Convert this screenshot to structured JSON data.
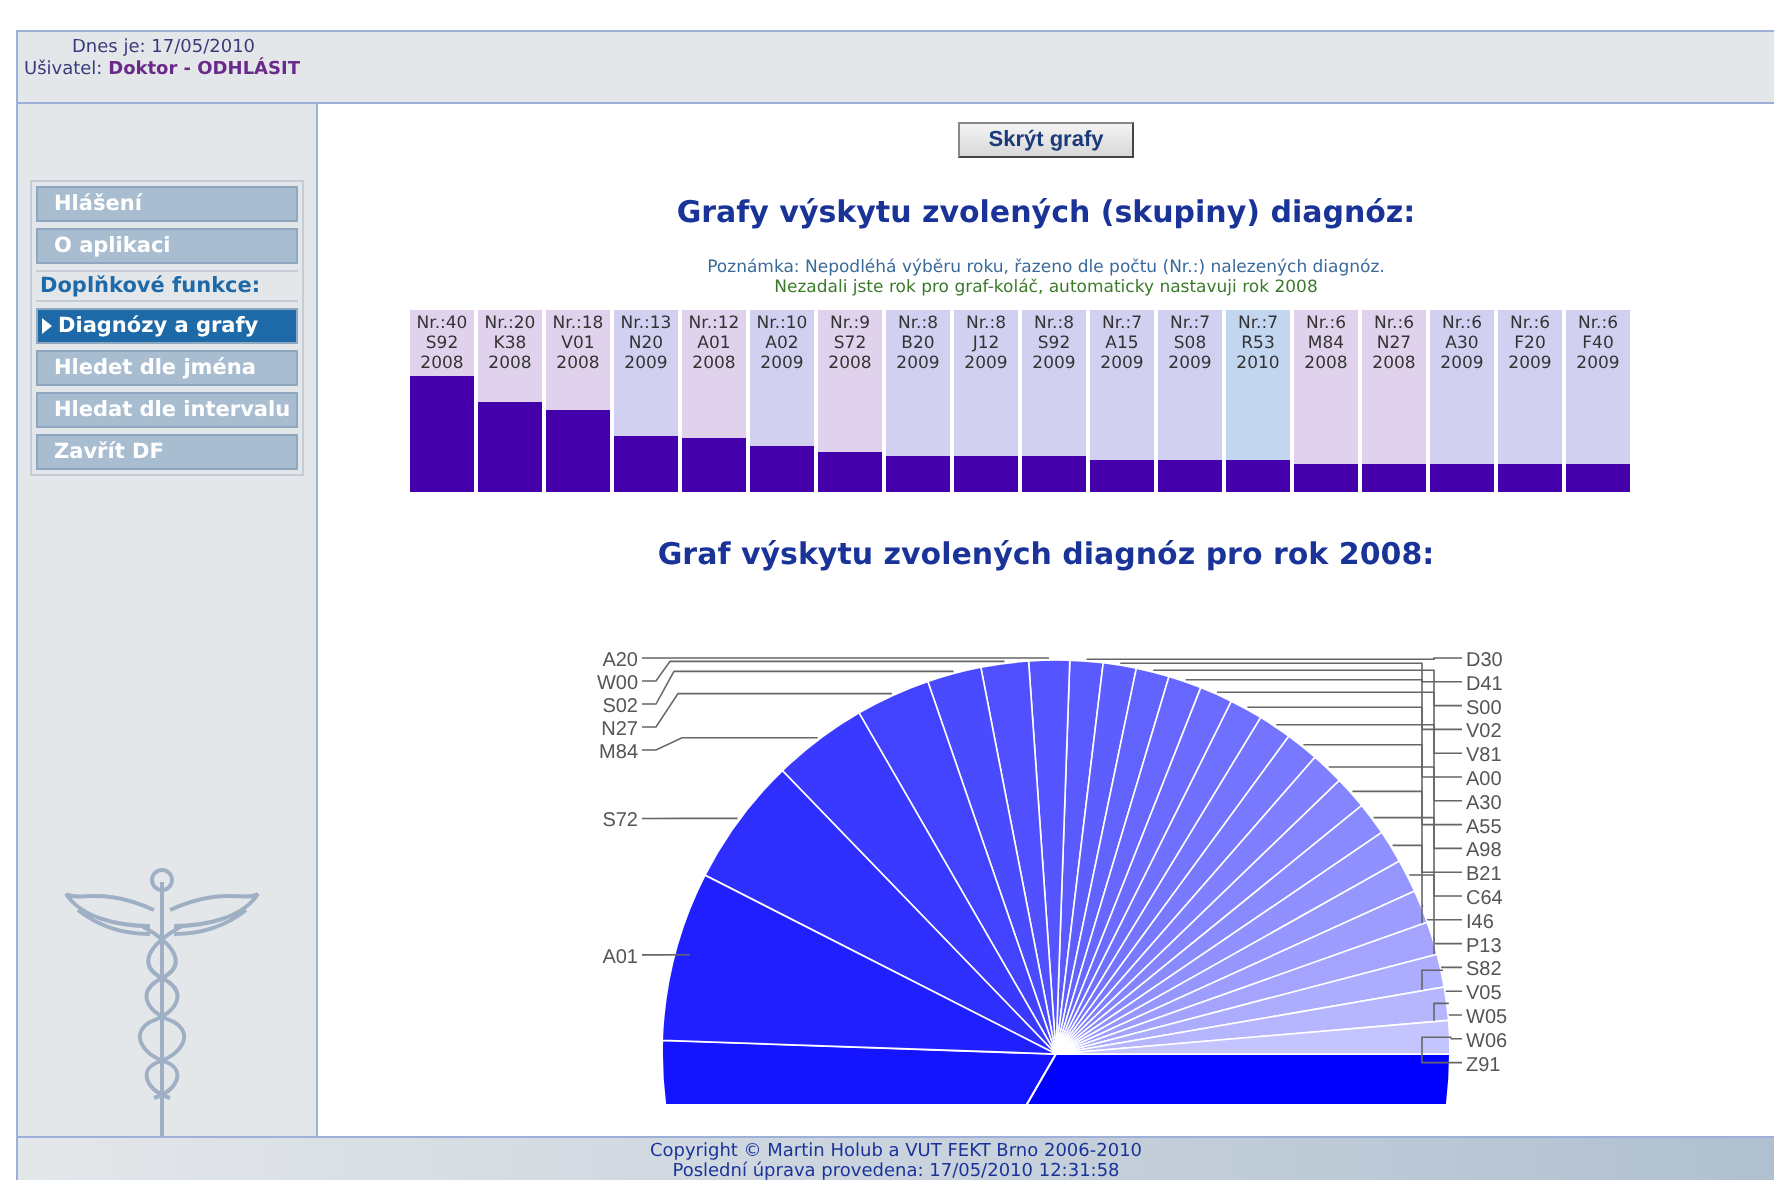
{
  "header": {
    "date_line": "Dnes je: 17/05/2010",
    "user_label": "Ušivatel:",
    "user_link": "Doktor - ODHLÁSIT"
  },
  "sidebar": {
    "items": [
      {
        "kind": "link",
        "label": "Hlášení",
        "selected": false
      },
      {
        "kind": "link",
        "label": "O aplikaci",
        "selected": false
      },
      {
        "kind": "heading",
        "label": "Doplňkové funkce:"
      },
      {
        "kind": "link",
        "label": "Diagnózy a grafy",
        "selected": true
      },
      {
        "kind": "link",
        "label": "Hledet dle jména",
        "selected": false
      },
      {
        "kind": "link",
        "label": "Hledat dle intervalu",
        "selected": false
      },
      {
        "kind": "link",
        "label": "Zavřít DF",
        "selected": false
      }
    ]
  },
  "main": {
    "hide_button": "Skrýt grafy",
    "title": "Grafy výskytu zvolených (skupiny) diagnóz:",
    "note": "Poznámka: Nepodléhá výběru roku, řazeno dle počtu (Nr.:) nalezených diagnóz.",
    "warning": "Nezadali jste rok pro graf-koláč, automaticky nastavuji rok 2008",
    "bars": [
      {
        "count": "Nr.:40",
        "code": "S92",
        "year": "2008",
        "color": "#e0d2ec",
        "level": 0.64
      },
      {
        "count": "Nr.:20",
        "code": "K38",
        "year": "2008",
        "color": "#e0d2ec",
        "level": 0.49
      },
      {
        "count": "Nr.:18",
        "code": "V01",
        "year": "2008",
        "color": "#e0d2ec",
        "level": 0.45
      },
      {
        "count": "Nr.:13",
        "code": "N20",
        "year": "2009",
        "color": "#d2d0f0",
        "level": 0.31
      },
      {
        "count": "Nr.:12",
        "code": "A01",
        "year": "2008",
        "color": "#e0d2ec",
        "level": 0.3
      },
      {
        "count": "Nr.:10",
        "code": "A02",
        "year": "2009",
        "color": "#d2d0f0",
        "level": 0.25
      },
      {
        "count": "Nr.:9",
        "code": "S72",
        "year": "2008",
        "color": "#e0d2ec",
        "level": 0.22
      },
      {
        "count": "Nr.:8",
        "code": "B20",
        "year": "2009",
        "color": "#d2d0f0",
        "level": 0.2
      },
      {
        "count": "Nr.:8",
        "code": "J12",
        "year": "2009",
        "color": "#d2d0f0",
        "level": 0.2
      },
      {
        "count": "Nr.:8",
        "code": "S92",
        "year": "2009",
        "color": "#d2d0f0",
        "level": 0.2
      },
      {
        "count": "Nr.:7",
        "code": "A15",
        "year": "2009",
        "color": "#d2d0f0",
        "level": 0.18
      },
      {
        "count": "Nr.:7",
        "code": "S08",
        "year": "2009",
        "color": "#d2d0f0",
        "level": 0.18
      },
      {
        "count": "Nr.:7",
        "code": "R53",
        "year": "2010",
        "color": "#c2d6f0",
        "level": 0.18
      },
      {
        "count": "Nr.:6",
        "code": "M84",
        "year": "2008",
        "color": "#e0d2ec",
        "level": 0.15
      },
      {
        "count": "Nr.:6",
        "code": "N27",
        "year": "2008",
        "color": "#e0d2ec",
        "level": 0.15
      },
      {
        "count": "Nr.:6",
        "code": "A30",
        "year": "2009",
        "color": "#d2d0f0",
        "level": 0.15
      },
      {
        "count": "Nr.:6",
        "code": "F20",
        "year": "2009",
        "color": "#d2d0f0",
        "level": 0.15
      },
      {
        "count": "Nr.:6",
        "code": "F40",
        "year": "2009",
        "color": "#d2d0f0",
        "level": 0.15
      }
    ],
    "pie_title": "Graf výskytu zvolených diagnóz pro rok 2008:",
    "pie": {
      "left_labels": [
        "A20",
        "W00",
        "S02",
        "N27",
        "M84",
        "S72",
        "A01"
      ],
      "right_labels": [
        "D30",
        "D41",
        "S00",
        "V02",
        "V81",
        "A00",
        "A30",
        "A55",
        "A98",
        "B21",
        "C64",
        "I46",
        "P13",
        "S82",
        "V05",
        "W05",
        "W06",
        "Z91"
      ]
    }
  },
  "footer": {
    "copyright": "Copyright © Martin Holub a VUT FEKT Brno 2006-2010",
    "updated": "Poslední úprava provedena: 17/05/2010 12:31:58"
  }
}
